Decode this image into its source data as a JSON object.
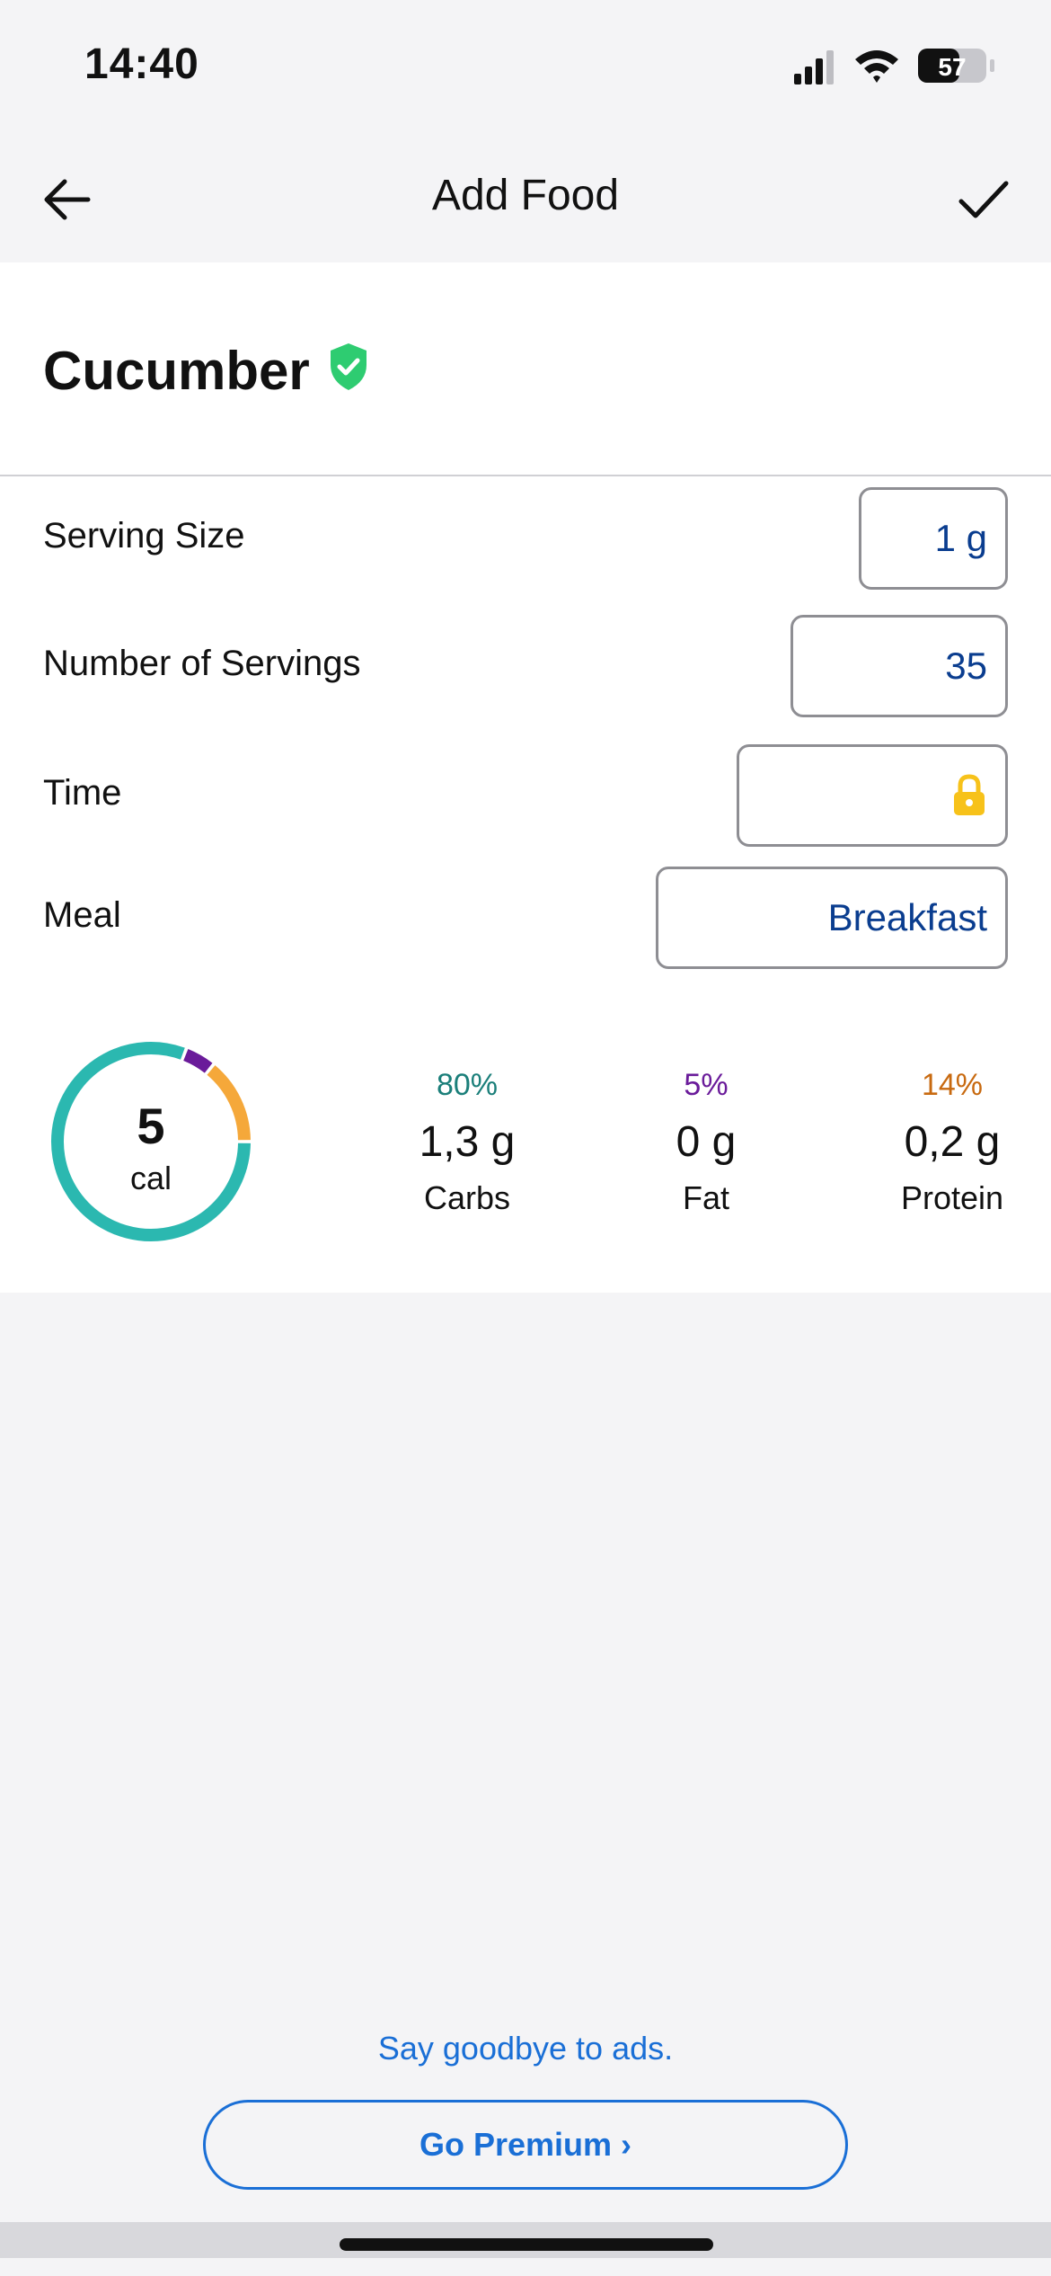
{
  "status_bar": {
    "time": "14:40",
    "battery": "57",
    "icons": [
      "signal-icon",
      "wifi-icon",
      "battery-icon"
    ]
  },
  "nav": {
    "title": "Add Food",
    "back_icon": "arrow-left-icon",
    "confirm_icon": "checkmark-icon"
  },
  "food": {
    "name": "Cucumber",
    "verified_icon": "verified-shield-icon",
    "verified_color": "#2ecc71"
  },
  "form": {
    "serving_size": {
      "label": "Serving Size",
      "value": "1 g"
    },
    "servings": {
      "label": "Number of Servings",
      "value": "35"
    },
    "time": {
      "label": "Time",
      "value": "",
      "icon": "lock-icon",
      "icon_color": "#f7c21a"
    },
    "meal": {
      "label": "Meal",
      "value": "Breakfast"
    }
  },
  "nutrition": {
    "calories": "5",
    "calories_unit": "cal",
    "macros": [
      {
        "name": "Carbs",
        "percent_label": "80%",
        "percent": 80,
        "value": "1,3 g",
        "color": "#2bb8b0"
      },
      {
        "name": "Fat",
        "percent_label": "5%",
        "percent": 5,
        "value": "0 g",
        "color": "#6a1b9a"
      },
      {
        "name": "Protein",
        "percent_label": "14%",
        "percent": 14,
        "value": "0,2 g",
        "color": "#f5a83a"
      }
    ],
    "percent_text_colors": [
      "#1b7f7a",
      "#6a1b9a",
      "#c86a10"
    ]
  },
  "promo": {
    "text": "Say goodbye to ads.",
    "button_label": "Go Premium ›",
    "accent": "#1a6fd6"
  }
}
